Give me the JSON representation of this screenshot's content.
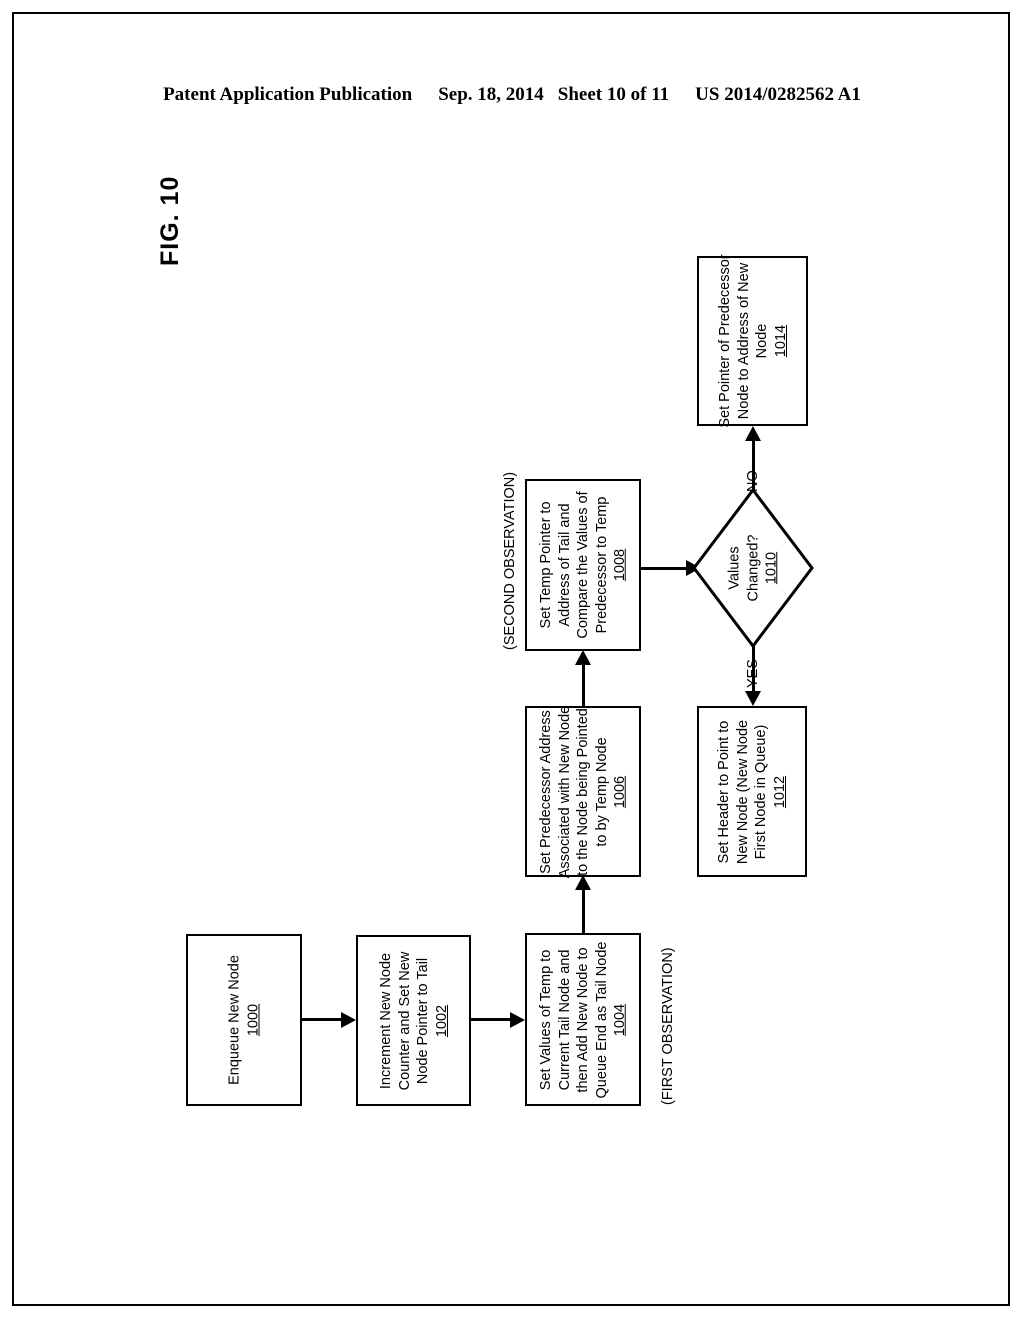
{
  "header": {
    "publication": "Patent Application Publication",
    "date": "Sep. 18, 2014",
    "sheet": "Sheet 10 of 11",
    "patent_number": "US 2014/0282562 A1"
  },
  "figure": {
    "label": "FIG. 10"
  },
  "annotations": {
    "first_observation": "(FIRST OBSERVATION)",
    "second_observation": "(SECOND OBSERVATION)"
  },
  "branches": {
    "no": "NO",
    "yes": "YES"
  },
  "nodes": {
    "n1000": {
      "lines": [
        "Enqueue New Node"
      ],
      "ref": "1000",
      "shape": "process"
    },
    "n1002": {
      "lines": [
        "Increment New Node",
        "Counter and Set New",
        "Node Pointer to Tail"
      ],
      "ref": "1002",
      "shape": "process"
    },
    "n1004": {
      "lines": [
        "Set Values of Temp to",
        "Current Tail Node and",
        "then Add New Node to",
        "Queue End as Tail Node"
      ],
      "ref": "1004",
      "shape": "process"
    },
    "n1006": {
      "lines": [
        "Set Predecessor Address",
        "Associated with New Node",
        "to the Node being Pointed",
        "to by Temp Node"
      ],
      "ref": "1006",
      "shape": "process"
    },
    "n1008": {
      "lines": [
        "Set Temp Pointer to",
        "Address of Tail and",
        "Compare the Values of",
        "Predecessor to Temp"
      ],
      "ref": "1008",
      "shape": "process"
    },
    "n1010": {
      "lines": [
        "Values",
        "Changed?"
      ],
      "ref": "1010",
      "shape": "decision"
    },
    "n1012": {
      "lines": [
        "Set Header to Point to",
        "New Node (New Node",
        "First Node in Queue)"
      ],
      "ref": "1012",
      "shape": "process"
    },
    "n1014": {
      "lines": [
        "Set Pointer of Predecessor",
        "Node to Address of New",
        "Node"
      ],
      "ref": "1014",
      "shape": "process"
    }
  },
  "colors": {
    "ink": "#000000",
    "paper": "#ffffff"
  }
}
